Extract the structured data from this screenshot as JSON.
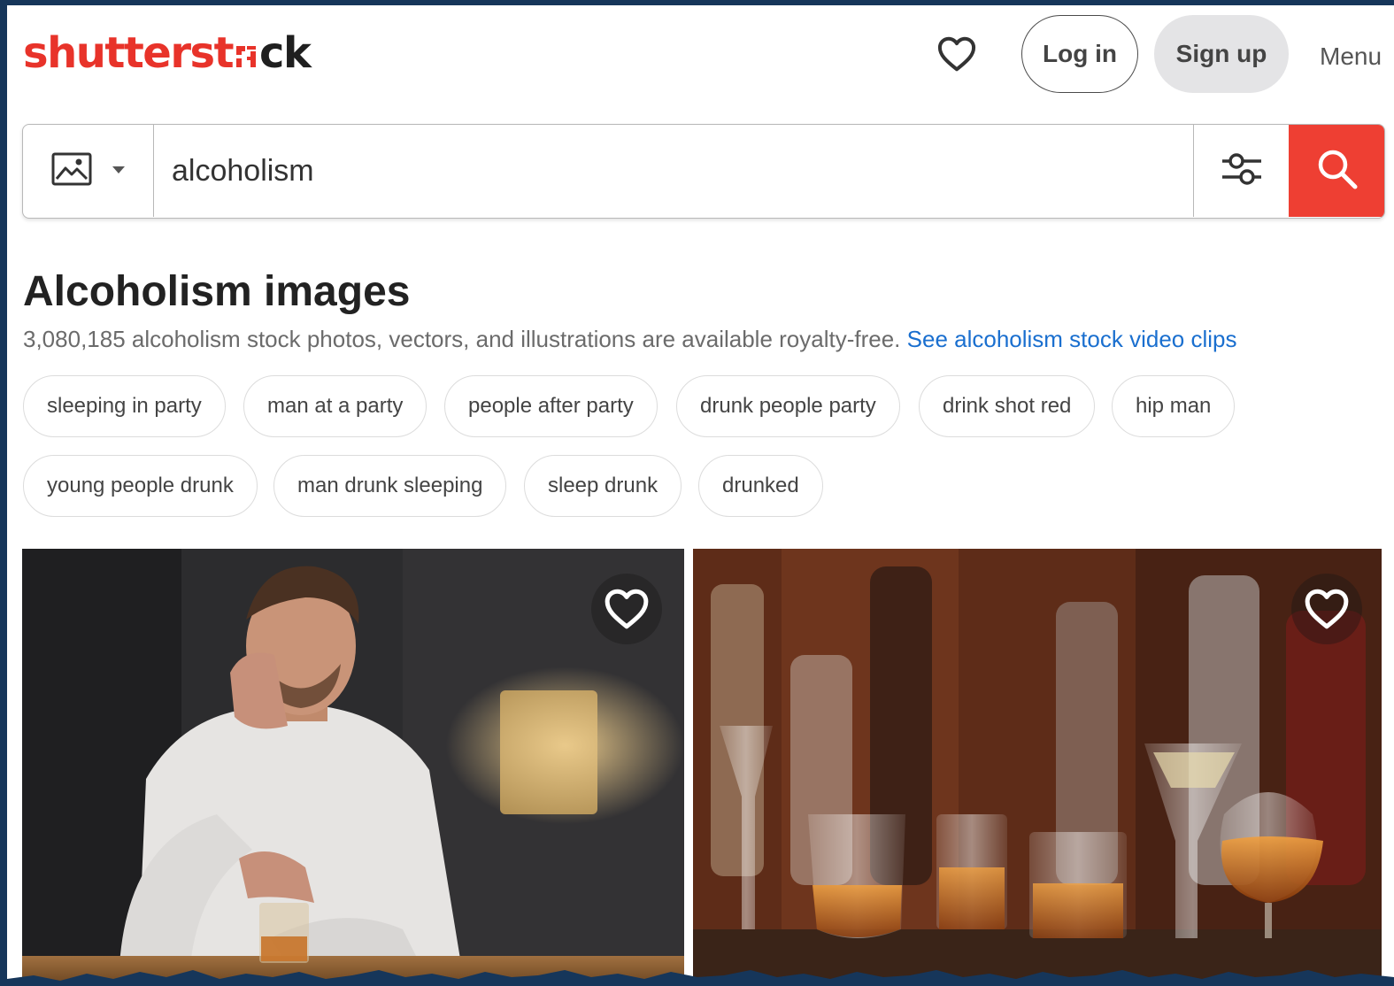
{
  "header": {
    "logo_part1": "shutterst",
    "logo_part2": "ck",
    "login_label": "Log in",
    "signup_label": "Sign up",
    "menu_label": "Menu"
  },
  "search": {
    "query": "alcoholism",
    "placeholder": ""
  },
  "results": {
    "title": "Alcoholism images",
    "summary": "3,080,185 alcoholism stock photos, vectors, and illustrations are available royalty-free.",
    "video_link": "See alcoholism stock video clips"
  },
  "related_searches": [
    "sleeping in party",
    "man at a party",
    "people after party",
    "drunk people party",
    "drink shot red",
    "hip man",
    "young people drunk",
    "man drunk sleeping",
    "sleep drunk",
    "drunked"
  ],
  "colors": {
    "brand_red": "#e8332a",
    "search_button": "#ee3f33",
    "link_blue": "#1a6fcf",
    "frame_navy": "#16365a"
  },
  "icons": {
    "favorites": "heart-icon",
    "media_type": "image-icon",
    "filters": "sliders-icon",
    "search": "search-icon"
  }
}
